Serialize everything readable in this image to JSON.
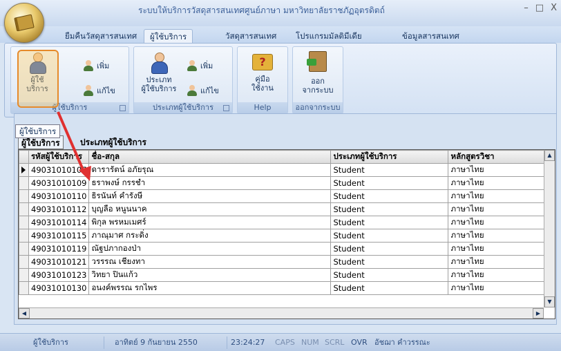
{
  "window": {
    "title": "ระบบให้บริการวัสดุสารสนเทศศูนย์ภาษา มหาวิทยาลัยราชภัฏอุตรดิตถ์",
    "min": "–",
    "max": "□",
    "close": "X"
  },
  "tabs": [
    "ยืมคืนวัสดุสารสนเทศ",
    "ผู้ใช้บริการ",
    "วัสดุสารสนเทศ",
    "โปรแกรมมัลติมีเดีย",
    "ข้อมูลสารสนเทศ"
  ],
  "ribbon": {
    "group_users": {
      "label": "ผู้ใช้บริการ",
      "big_btn_line1": "ผู้ใช้",
      "big_btn_line2": "บริการ",
      "add": "เพิ่ม",
      "edit": "แก้ไข"
    },
    "group_types": {
      "label": "ประเภทผู้ใช้บริการ",
      "big_btn_line1": "ประเภท",
      "big_btn_line2": "ผู้ใช้บริการ",
      "add": "เพิ่ม",
      "edit": "แก้ไข"
    },
    "group_help": {
      "label": "Help",
      "big_btn_line1": "คู่มือ",
      "big_btn_line2": "ใช้งาน"
    },
    "group_exit": {
      "label": "ออกจากระบบ",
      "big_btn_line1": "ออก",
      "big_btn_line2": "จากระบบ"
    }
  },
  "tooltip": "ผู้ใช้บริการ",
  "subtabs": [
    "ผู้ใช้บริการ",
    "ประเภทผู้ใช้บริการ"
  ],
  "grid": {
    "columns": [
      "รหัสผู้ใช้บริการ",
      "ชื่อ-สกุล",
      "ประเภทผู้ใช้บริการ",
      "หลักสูตรวิชา"
    ],
    "rows": [
      [
        "49031010107",
        "ดารารัตน์ อภัยรุณ",
        "Student",
        "ภาษาไทย"
      ],
      [
        "49031010109",
        "ธราพงษ์ กรรชำ",
        "Student",
        "ภาษาไทย"
      ],
      [
        "49031010110",
        "ธิรนันท์ คำรังษี",
        "Student",
        "ภาษาไทย"
      ],
      [
        "49031010112",
        "บุญลือ หนูนนาค",
        "Student",
        "ภาษาไทย"
      ],
      [
        "49031010114",
        "พิกุล พรหมเมศร์",
        "Student",
        "ภาษาไทย"
      ],
      [
        "49031010115",
        "ภาณุมาศ กระดิ่ง",
        "Student",
        "ภาษาไทย"
      ],
      [
        "49031010119",
        "ณัฐปภากองป่า",
        "Student",
        "ภาษาไทย"
      ],
      [
        "49031010121",
        "วรรรณ เชียงทา",
        "Student",
        "ภาษาไทย"
      ],
      [
        "49031010123",
        "วิทยา ปินแก้ว",
        "Student",
        "ภาษาไทย"
      ],
      [
        "49031010130",
        "อนงค์พรรณ รกไพร",
        "Student",
        "ภาษาไทย"
      ]
    ]
  },
  "status": {
    "section": "ผู้ใช้บริการ",
    "date": "อาทิตย์ 9 กันยายน 2550",
    "time": "23:24:27",
    "caps": "CAPS",
    "num": "NUM",
    "scrl": "SCRL",
    "ovr": "OVR",
    "user": "อัชฌา คำวรรณะ"
  },
  "colors": {
    "accent_orange": "#e68a2a",
    "arrow_red": "#e03030",
    "ribbon_blue": "#d3e1f3"
  }
}
